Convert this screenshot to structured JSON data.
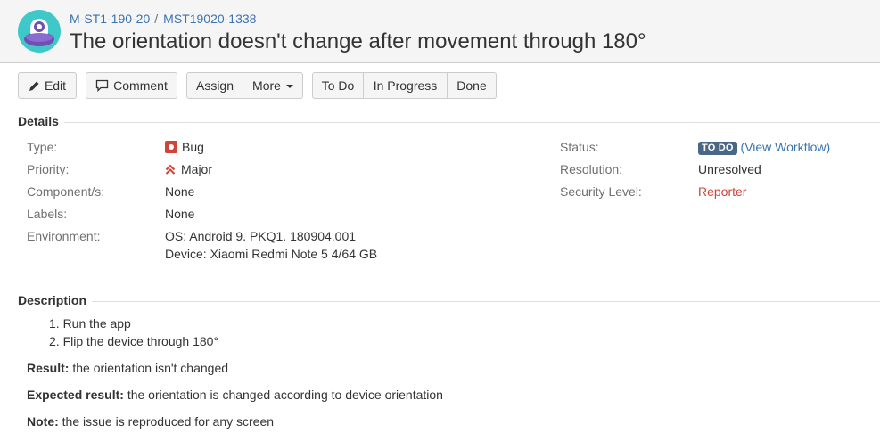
{
  "breadcrumb": {
    "project": "M-ST1-190-20",
    "separator": "/",
    "issue_key": "MST19020-1338"
  },
  "issue": {
    "title": "The orientation doesn't change after movement through 180°"
  },
  "toolbar": {
    "edit_label": "Edit",
    "comment_label": "Comment",
    "assign_label": "Assign",
    "more_label": "More",
    "todo_label": "To Do",
    "in_progress_label": "In Progress",
    "done_label": "Done"
  },
  "details": {
    "heading": "Details",
    "type_label": "Type:",
    "type_value": "Bug",
    "priority_label": "Priority:",
    "priority_value": "Major",
    "components_label": "Component/s:",
    "components_value": "None",
    "labels_label": "Labels:",
    "labels_value": "None",
    "environment_label": "Environment:",
    "environment_line1": "OS: Android 9. PKQ1. 180904.001",
    "environment_line2": "Device: Xiaomi Redmi Note 5 4/64 GB",
    "status_label": "Status:",
    "status_value": "TO DO",
    "view_workflow_open": "(",
    "view_workflow_link": "View Workflow",
    "view_workflow_close": ")",
    "resolution_label": "Resolution:",
    "resolution_value": "Unresolved",
    "security_label": "Security Level:",
    "security_value": "Reporter"
  },
  "description": {
    "heading": "Description",
    "steps": [
      "1. Run the app",
      "2. Flip the device through 180°"
    ],
    "result_label": "Result:",
    "result_text": " the orientation isn't changed",
    "expected_label": "Expected result:",
    "expected_text": " the orientation is changed according to device orientation",
    "note_label": "Note:",
    "note_text": " the issue is reproduced for any screen"
  },
  "colors": {
    "link": "#3b73af",
    "bug": "#d04437",
    "priority_major": "#d04437",
    "lozenge_todo": "#4a6785",
    "reporter": "#d04437"
  },
  "icons": {
    "avatar": "project-avatar-icon",
    "edit": "pencil-icon",
    "comment": "speech-bubble-icon",
    "more": "chevron-down-icon",
    "type": "bug-icon",
    "priority": "major-priority-icon"
  }
}
